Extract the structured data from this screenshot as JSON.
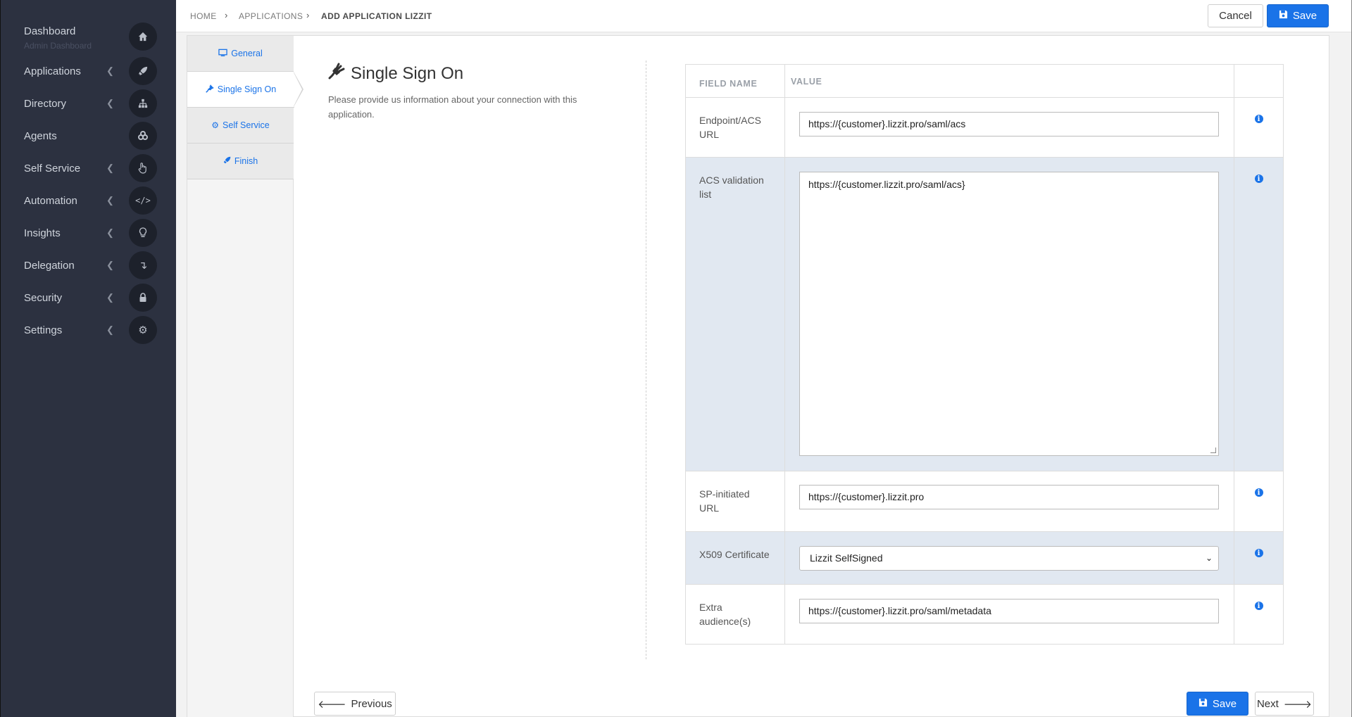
{
  "sidebar": {
    "items": [
      {
        "label": "Dashboard",
        "sub": "Admin Dashboard",
        "icon": "home-icon",
        "chevron": false
      },
      {
        "label": "Applications",
        "icon": "rocket-icon",
        "chevron": true
      },
      {
        "label": "Directory",
        "icon": "sitemap-icon",
        "chevron": true
      },
      {
        "label": "Agents",
        "icon": "cogs-icon",
        "chevron": false
      },
      {
        "label": "Self Service",
        "icon": "hand-pointer-icon",
        "chevron": true
      },
      {
        "label": "Automation",
        "icon": "code-icon",
        "chevron": true
      },
      {
        "label": "Insights",
        "icon": "lightbulb-icon",
        "chevron": true
      },
      {
        "label": "Delegation",
        "icon": "level-down-icon",
        "chevron": true
      },
      {
        "label": "Security",
        "icon": "lock-icon",
        "chevron": true
      },
      {
        "label": "Settings",
        "icon": "gear-icon",
        "chevron": true
      }
    ]
  },
  "breadcrumb": [
    "HOME",
    "APPLICATIONS",
    "ADD APPLICATION LIZZIT"
  ],
  "toolbar": {
    "cancel_label": "Cancel",
    "save_label": "Save"
  },
  "tabs": [
    {
      "label": "General",
      "icon": "desktop-icon"
    },
    {
      "label": "Single Sign On",
      "icon": "plug-icon",
      "active": true
    },
    {
      "label": "Self Service",
      "icon": "cogs-icon"
    },
    {
      "label": "Finish",
      "icon": "rocket-icon"
    }
  ],
  "section": {
    "title": "Single Sign On",
    "description": "Please provide us information about your connection with this application."
  },
  "table": {
    "headers": {
      "field": "FIELD NAME",
      "value": "VALUE"
    },
    "rows": [
      {
        "name": "Endpoint/ACS URL",
        "value": "https://{customer}.lizzit.pro/saml/acs"
      },
      {
        "name": "ACS validation list",
        "value": "https://{customer.lizzit.pro/saml/acs}"
      },
      {
        "name": "SP-initiated URL",
        "value": "https://{customer}.lizzit.pro"
      },
      {
        "name": "X509 Certificate",
        "value": "Lizzit SelfSigned"
      },
      {
        "name": "Extra audience(s)",
        "value": "https://{customer}.lizzit.pro/saml/metadata"
      }
    ]
  },
  "footer": {
    "previous_label": "Previous",
    "save_label": "Save",
    "next_label": "Next"
  },
  "colors": {
    "accent": "#1a73e8",
    "sidebar": "#2c3140",
    "row_shade": "#e1e8f1"
  }
}
